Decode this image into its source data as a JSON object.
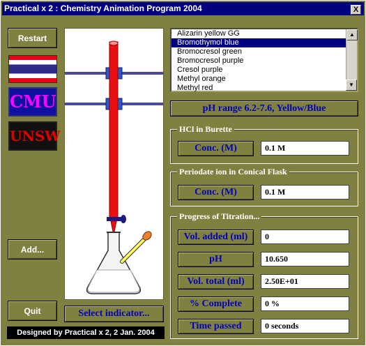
{
  "window": {
    "title": "Practical x 2 : Chemistry Animation Program 2004",
    "close_label": "X"
  },
  "buttons": {
    "restart": "Restart",
    "add": "Add...",
    "quit": "Quit"
  },
  "logos": {
    "cmu": "CMU",
    "unsw": "UNSW"
  },
  "indicators": {
    "items": [
      "Alizarin yellow GG",
      "Bromothymol blue",
      "Bromocresol green",
      "Bromocresol purple",
      "Cresol purple",
      "Methyl orange",
      "Methyl red"
    ],
    "selected": "Bromothymol blue"
  },
  "ph_range": "pH range 6.2-7.6, Yellow/Blue",
  "burette": {
    "title": "HCl in Burette",
    "label": "Conc. (M)",
    "value": "0.1 M"
  },
  "flask": {
    "title": "Periodate ion in Conical Flask",
    "label": "Conc. (M)",
    "value": "0.1 M"
  },
  "progress": {
    "title": "Progress of Titration...",
    "rows": [
      {
        "label": "Vol. added (ml)",
        "value": "0"
      },
      {
        "label": "pH",
        "value": "10.650"
      },
      {
        "label": "Vol. total (ml)",
        "value": "2.50E+01"
      },
      {
        "label": "% Complete",
        "value": "0 %"
      },
      {
        "label": "Time passed",
        "value": "0 seconds"
      }
    ]
  },
  "select_indicator": "Select indicator...",
  "footer": "Designed by Practical x 2, 2 Jan. 2004",
  "colors": {
    "titlebar": "#000080",
    "window_bg": "#808040",
    "accent_text": "#0000c0",
    "burette_liquid": "#e81010",
    "clamp": "#4a4aa0"
  }
}
